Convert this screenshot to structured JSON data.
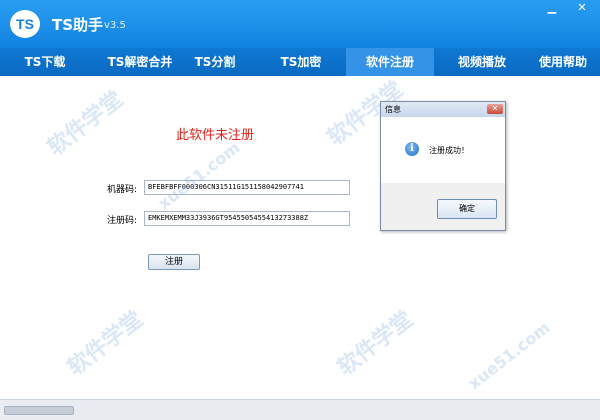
{
  "window": {
    "title": "TS助手",
    "version": "v3.5",
    "logo_text": "TS",
    "minimize_label": "▁",
    "close_label": "✕"
  },
  "nav": {
    "items": [
      {
        "label": "TS下载"
      },
      {
        "label": "TS解密合并"
      },
      {
        "label": "TS分割"
      },
      {
        "label": "TS加密"
      },
      {
        "label": "软件注册"
      },
      {
        "label": "视频播放"
      },
      {
        "label": "使用帮助"
      }
    ],
    "active": "软件注册"
  },
  "register": {
    "status_text": "此软件未注册",
    "machine_code_label": "机器码:",
    "machine_code_value": "BFEBFBFF000306CN31511G151158042907741",
    "reg_code_label": "注册码:",
    "reg_code_value": "EMKEMXEMM33J3936GT9545505455413273388Z",
    "register_button": "注册"
  },
  "dialog": {
    "title": "信息",
    "close_label": "✕",
    "icon": "info-icon",
    "message": "注册成功！",
    "ok_button": "确定"
  },
  "watermark": {
    "text_a": "软件学堂",
    "text_b": "xue51.com"
  },
  "colors": {
    "titlebar": "#1a8ee8",
    "navbar": "#0a6ac2",
    "active_tab": "#3493e6",
    "status_text": "#e0241b"
  }
}
